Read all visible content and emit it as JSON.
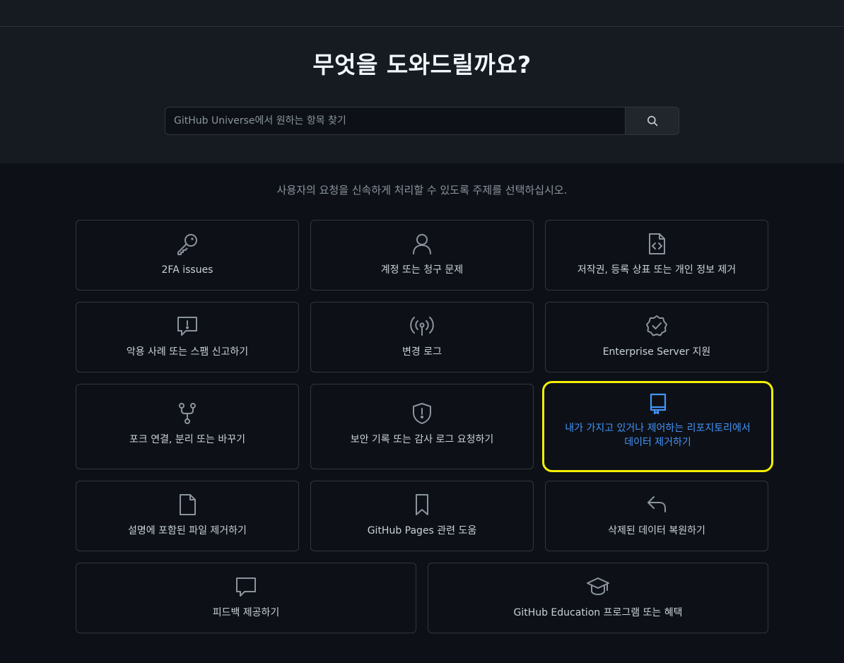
{
  "hero": {
    "title": "무엇을 도와드릴까요?",
    "search_placeholder": "GitHub Universe에서 원하는 항목 찾기"
  },
  "subtitle": "사용자의 요청을 신속하게 처리할 수 있도록 주제를 선택하십시오.",
  "cards": [
    {
      "icon": "key-icon",
      "label": "2FA issues"
    },
    {
      "icon": "person-icon",
      "label": "계정 또는 청구 문제"
    },
    {
      "icon": "file-code-icon",
      "label": "저작권, 등록 상표 또는 개인 정보 제거"
    },
    {
      "icon": "report-icon",
      "label": "악용 사례 또는 스팸 신고하기"
    },
    {
      "icon": "broadcast-icon",
      "label": "변경 로그"
    },
    {
      "icon": "verified-icon",
      "label": "Enterprise Server 지원"
    },
    {
      "icon": "repo-forked-icon",
      "label": "포크 연결, 분리 또는 바꾸기"
    },
    {
      "icon": "shield-alert-icon",
      "label": "보안 기록 또는 감사 로그 요청하기"
    },
    {
      "icon": "repo-icon",
      "label_line1": "내가 가지고 있거나 제어하는 리포지토리에서",
      "label_line2": "데이터 제거하기"
    },
    {
      "icon": "file-icon",
      "label": "설명에 포함된 파일 제거하기"
    },
    {
      "icon": "bookmark-icon",
      "label": "GitHub Pages 관련 도움"
    },
    {
      "icon": "reply-icon",
      "label": "삭제된 데이터 복원하기"
    },
    {
      "icon": "comment-icon",
      "label": "피드백 제공하기"
    },
    {
      "icon": "mortar-board-icon",
      "label": "GitHub Education 프로그램 또는 혜택"
    }
  ],
  "colors": {
    "background": "#0d1117",
    "hero_background": "#161b22",
    "border": "#30363d",
    "highlight_border": "#f5f000",
    "highlight_text": "#4493f8"
  }
}
